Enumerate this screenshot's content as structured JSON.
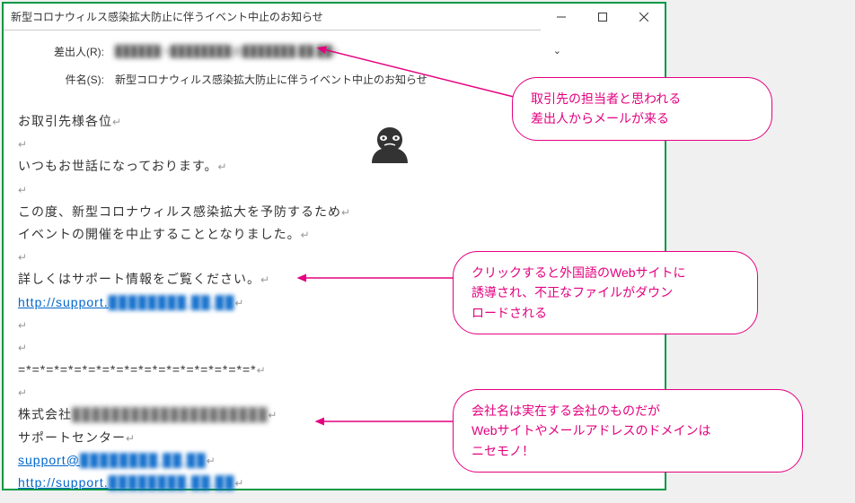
{
  "window": {
    "title": "新型コロナウィルス感染拡大防止に伴うイベント中止のお知らせ"
  },
  "header": {
    "sender_label": "差出人(R):",
    "sender_value": "██████ <████████@███████.██.██>",
    "subject_label": "件名(S):",
    "subject_value": "新型コロナウィルス感染拡大防止に伴うイベント中止のお知らせ"
  },
  "body": {
    "line1": "お取引先様各位",
    "line2": "いつもお世話になっております。",
    "line3": "この度、新型コロナウィルス感染拡大を予防するため",
    "line4": "イベントの開催を中止することとなりました。",
    "line5": "詳しくはサポート情報をご覧ください。",
    "link1_prefix": "http://support.",
    "link1_blurred": "████████.██.██",
    "divider": "=*=*=*=*=*=*=*=*=*=*=*=*=*=*=*=*=*",
    "company_prefix": "株式会社",
    "company_blurred": "████████████████████",
    "support_center": "サポートセンター",
    "email_prefix": "support@",
    "email_blurred": "████████.██.██",
    "link2_prefix": "http://support.",
    "link2_blurred": "████████.██.██"
  },
  "callouts": {
    "c1_line1": "取引先の担当者と思われる",
    "c1_line2": "差出人からメールが来る",
    "c2_line1": "クリックすると外国語のWebサイトに",
    "c2_line2": "誘導され、不正なファイルがダウン",
    "c2_line3": "ロードされる",
    "c3_line1": "会社名は実在する会社のものだが",
    "c3_line2": "Webサイトやメールアドレスのドメインは",
    "c3_line3": "ニセモノ！"
  }
}
